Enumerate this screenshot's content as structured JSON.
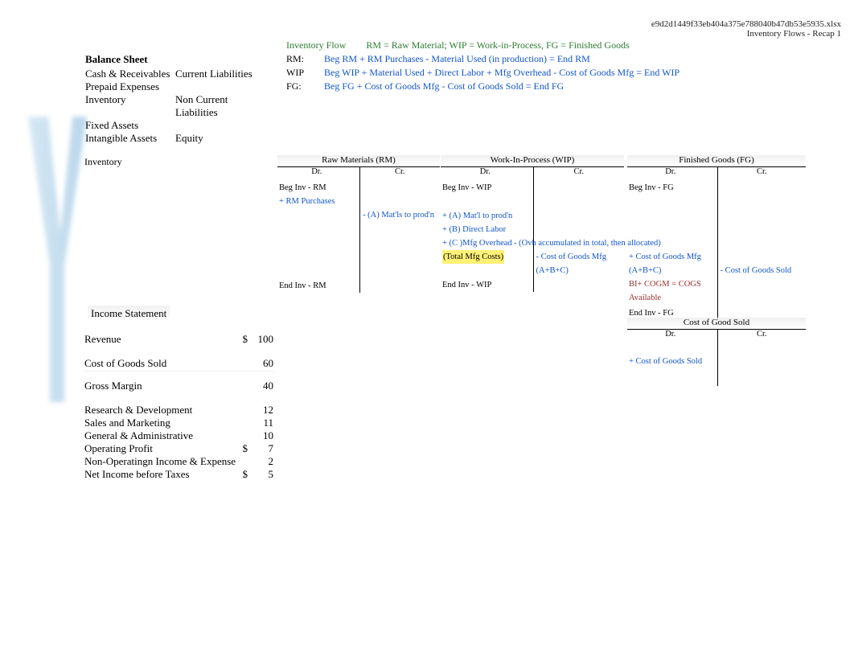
{
  "flow_header": {
    "label": "Inventory Flow",
    "desc": "RM = Raw Material; WIP = Work-in-Process, FG = Finished Goods"
  },
  "formulas": {
    "rm_k": "RM:",
    "rm_v": "Beg RM + RM Purchases - Material Used (in production) = End RM",
    "wip_k": "WIP",
    "wip_v": "Beg WIP + Material Used + Direct Labor + Mfg Overhead - Cost of Goods Mfg = End WIP",
    "fg_k": "FG:",
    "fg_v": "Beg FG + Cost of Goods Mfg - Cost of Goods Sold = End FG"
  },
  "balance_sheet": {
    "title": "Balance Sheet",
    "rows": [
      {
        "l": "Cash & Receivables",
        "r": "Current Liabilities"
      },
      {
        "l": "Prepaid Expenses",
        "r": ""
      },
      {
        "l": "Inventory",
        "r": "Non Current Liabilities"
      },
      {
        "l": "Fixed Assets",
        "r": ""
      },
      {
        "l": "Intangible Assets",
        "r": "Equity"
      }
    ]
  },
  "inv_label": "Inventory",
  "drcr": {
    "dr": "Dr.",
    "cr": "Cr."
  },
  "rm": {
    "title": "Raw Materials (RM)",
    "beg": "Beg Inv - RM",
    "add": "+ RM Purchases",
    "out": "- (A) Mat'ls to prod'n",
    "end": "End Inv - RM"
  },
  "wip": {
    "title": "Work-In-Process (WIP)",
    "beg": "Beg Inv - WIP",
    "matl": "+ (A) Mat'l to prod'n",
    "dl": "+ (B) Direct Labor",
    "ovh": "+ (C )Mfg Overhead",
    "ovh_note": "- (Ovh accumulated in total, then allocated)",
    "total": "(Total Mfg Costs)",
    "cogm_out": "- Cost of Goods Mfg (A+B+C)",
    "end": "End Inv - WIP"
  },
  "fg": {
    "title": "Finished Goods (FG)",
    "beg": "Beg Inv - FG",
    "cogm_in": "+ Cost of Goods Mfg (A+B+C)",
    "avail": "BI+ COGM = COGS Available",
    "cogs_out": "- Cost of Goods Sold",
    "end": "End Inv - FG"
  },
  "cogs_t": {
    "title": "Cost of Good Sold",
    "in": "+ Cost of Goods Sold"
  },
  "income": {
    "title": "Income Statement",
    "rows": [
      {
        "label": "Revenue",
        "cur": "$",
        "val": "100"
      },
      {
        "sep": true
      },
      {
        "label": "Cost of Goods Sold",
        "cur": "",
        "val": "60"
      },
      {
        "sep": true,
        "line": true
      },
      {
        "label": "Gross Margin",
        "cur": "",
        "val": "40"
      },
      {
        "sep": true
      },
      {
        "label": "Research & Development",
        "cur": "",
        "val": "12"
      },
      {
        "label": "Sales and Marketing",
        "cur": "",
        "val": "11"
      },
      {
        "label": "General & Administrative",
        "cur": "",
        "val": "10"
      },
      {
        "label": "Operating Profit",
        "cur": "$",
        "val": "7"
      },
      {
        "label": "Non-Operatingn Income & Expense",
        "cur": "",
        "val": "2"
      },
      {
        "label": "Net Income before Taxes",
        "cur": "$",
        "val": "5"
      }
    ]
  },
  "footer": {
    "file": "e9d2d1449f33eb404a375e788040b47db53e5935.xlsx",
    "sheet": "Inventory Flows - Recap 1"
  }
}
